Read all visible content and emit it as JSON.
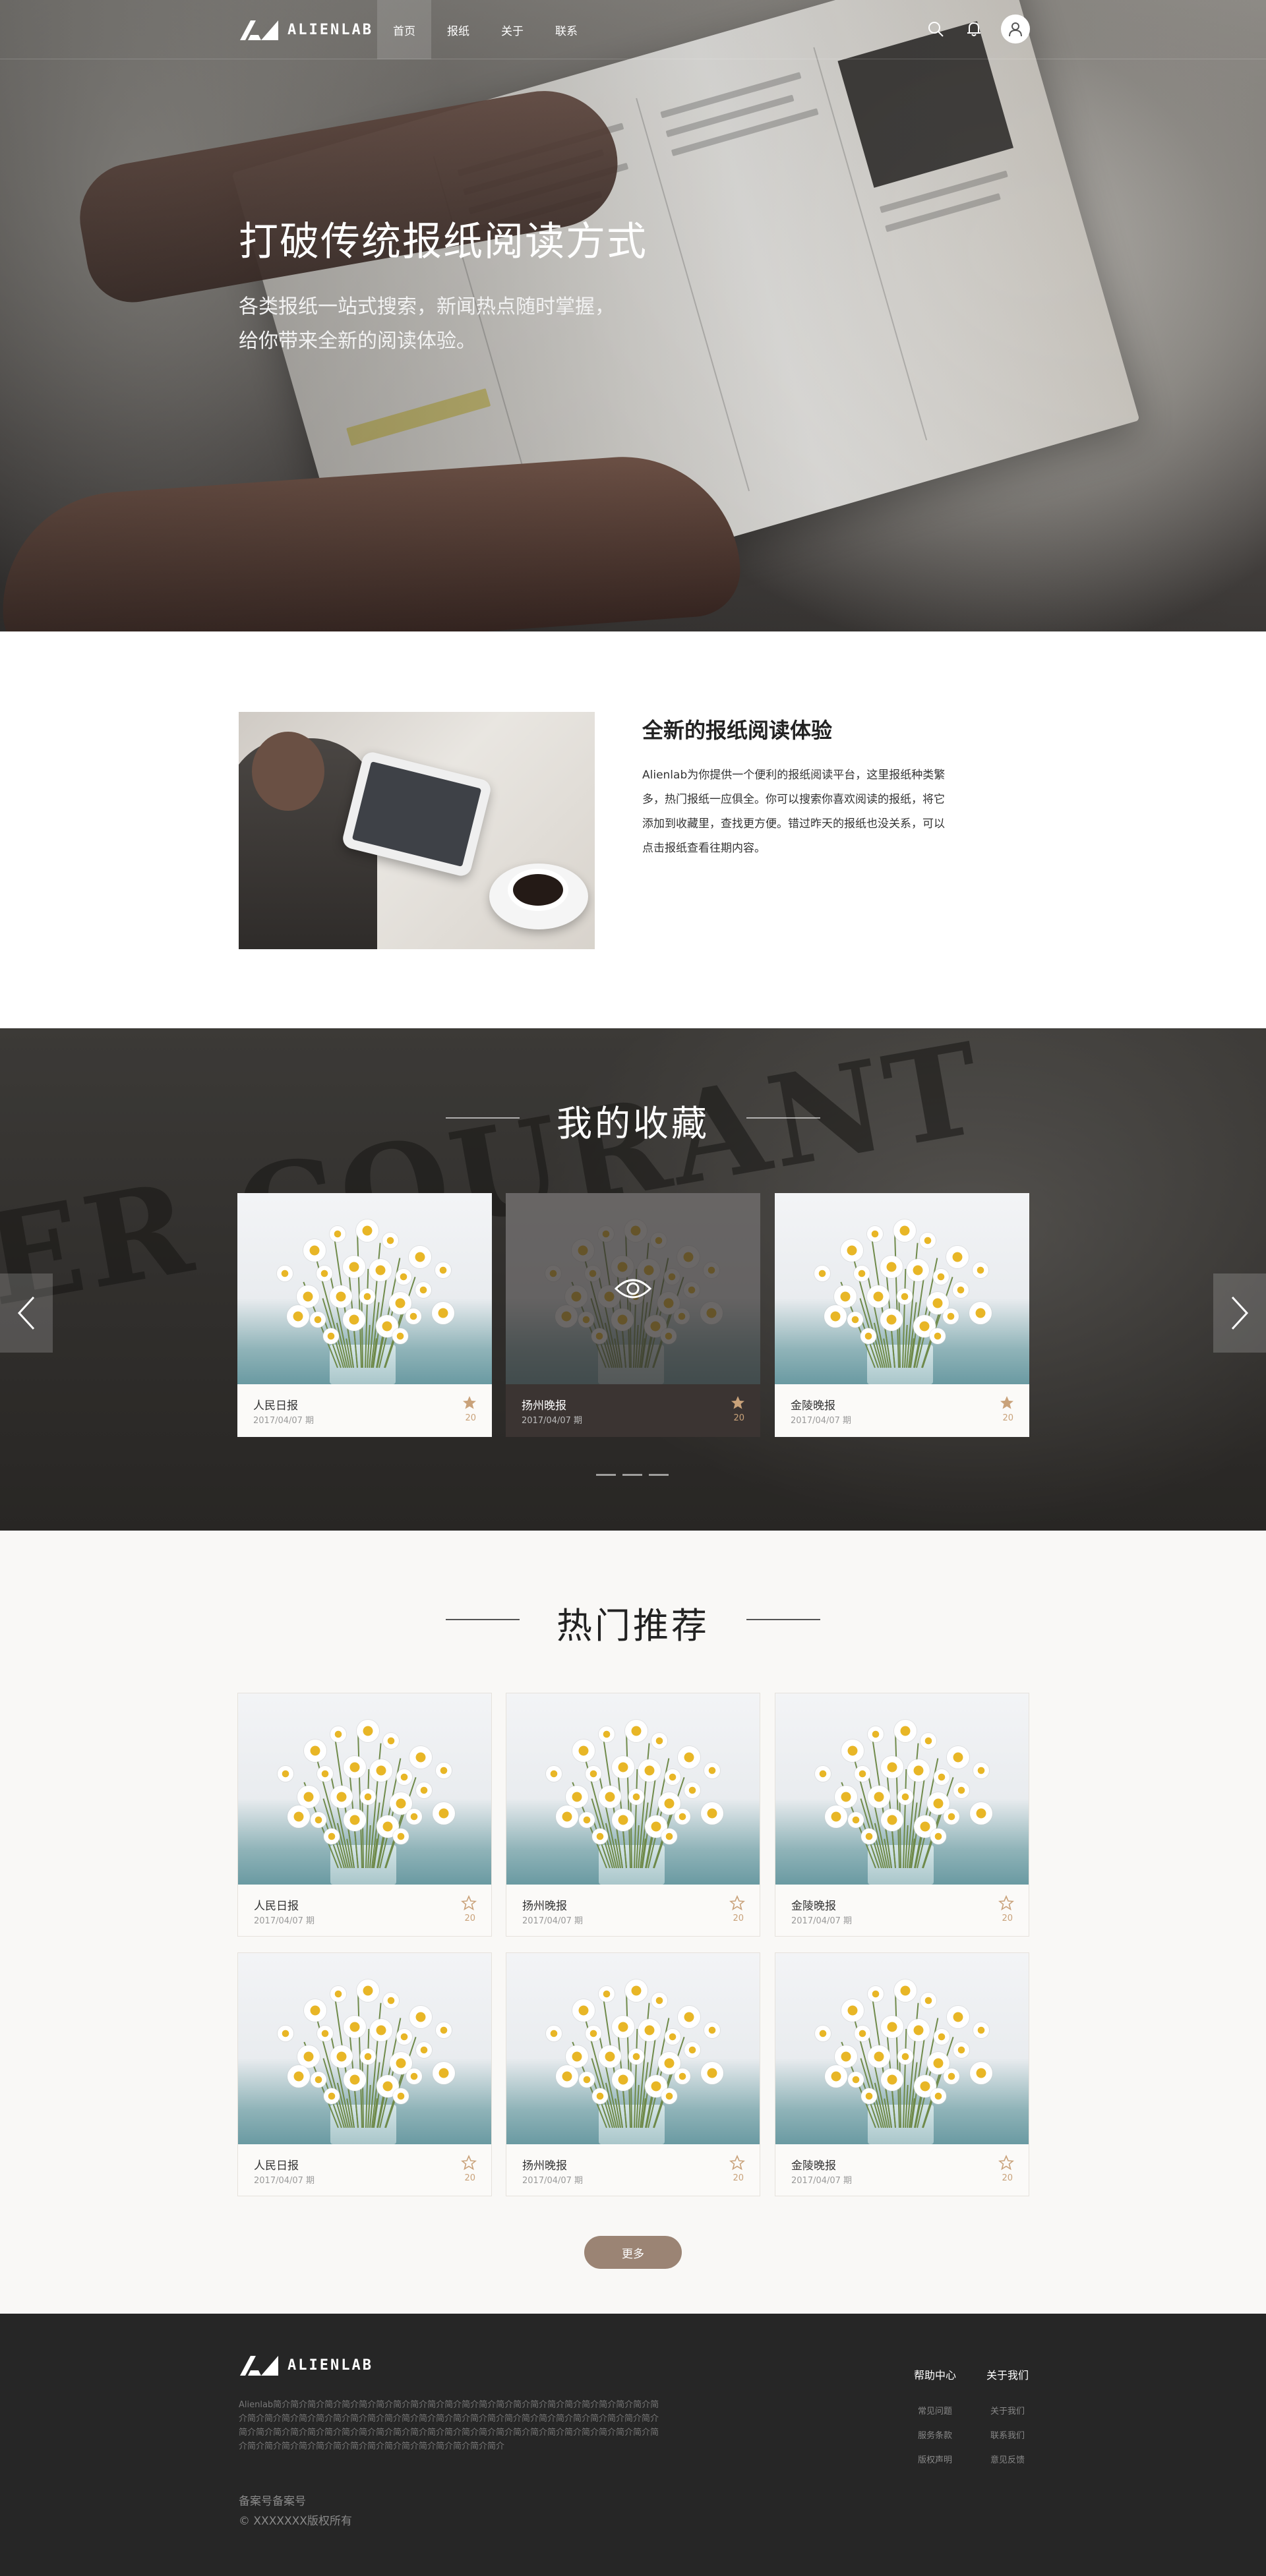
{
  "nav": {
    "logo_text": "ALIENLAB",
    "items": [
      {
        "label": "首页",
        "active": true
      },
      {
        "label": "报纸",
        "active": false
      },
      {
        "label": "关于",
        "active": false
      },
      {
        "label": "联系",
        "active": false
      }
    ],
    "icons": [
      "search-icon",
      "bell-icon",
      "user-icon"
    ]
  },
  "hero": {
    "title": "打破传统报纸阅读方式",
    "subtitle_line1": "各类报纸一站式搜索，新闻热点随时掌握，",
    "subtitle_line2": "给你带来全新的阅读体验。"
  },
  "about": {
    "title": "全新的报纸阅读体验",
    "text": "Alienlab为你提供一个便利的报纸阅读平台，这里报纸种类繁多，热门报纸一应俱全。你可以搜索你喜欢阅读的报纸，将它添加到收藏里，查找更方便。错过昨天的报纸也没关系，可以点击报纸查看往期内容。"
  },
  "favorites": {
    "title": "我的收藏",
    "background_text": "ER COURANT",
    "cards": [
      {
        "name": "人民日报",
        "date": "2017/04/07 期",
        "count": "20",
        "starred": true
      },
      {
        "name": "扬州晚报",
        "date": "2017/04/07 期",
        "count": "20",
        "starred": true
      },
      {
        "name": "金陵晚报",
        "date": "2017/04/07 期",
        "count": "20",
        "starred": true
      }
    ],
    "dots": 3
  },
  "hot": {
    "title": "热门推荐",
    "cards": [
      {
        "name": "人民日报",
        "date": "2017/04/07 期",
        "count": "20"
      },
      {
        "name": "扬州晚报",
        "date": "2017/04/07 期",
        "count": "20"
      },
      {
        "name": "金陵晚报",
        "date": "2017/04/07 期",
        "count": "20"
      },
      {
        "name": "人民日报",
        "date": "2017/04/07 期",
        "count": "20"
      },
      {
        "name": "扬州晚报",
        "date": "2017/04/07 期",
        "count": "20"
      },
      {
        "name": "金陵晚报",
        "date": "2017/04/07 期",
        "count": "20"
      }
    ],
    "more_label": "更多"
  },
  "footer": {
    "logo_text": "ALIENLAB",
    "description": "Alienlab简介简介简介简介简介简介简介简介简介简介简介简介简介简介简介简介简介简介简介简介简介简介简介简介简介简介简介简介简介简介简介简介简介简介简介简介简介简介简介简介简介简介简介简介简介简介简介简介简介简介简介简介简介简介简介简介简介简介简介简介简介简介简介简介简介简介简介简介简介简介简介简介简介简介简介简介简介简介简介简介简介简介简介简介简介简介简介",
    "icp": "备案号备案号",
    "copyright": "© XXXXXXX版权所有",
    "columns": [
      {
        "title": "帮助中心",
        "links": [
          "常见问题",
          "服务条款",
          "版权声明"
        ]
      },
      {
        "title": "关于我们",
        "links": [
          "关于我们",
          "联系我们",
          "意见反馈"
        ]
      }
    ]
  },
  "colors": {
    "accent": "#9b8474",
    "star": "#c9a27a",
    "footer_bg": "#262626",
    "hot_bg": "#f9f8f6"
  }
}
